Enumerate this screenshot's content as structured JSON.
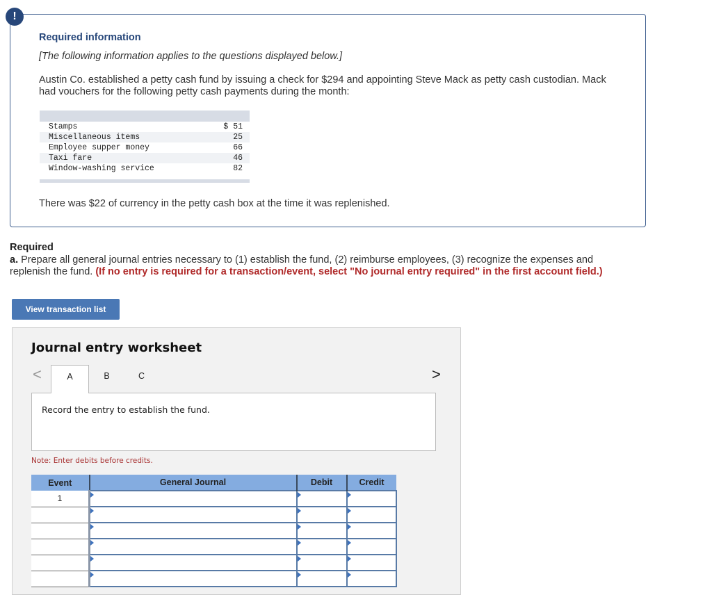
{
  "alert_icon": "!",
  "info": {
    "title": "Required information",
    "italic_note": "[The following information applies to the questions displayed below.]",
    "paragraph": "Austin Co. established a petty cash fund by issuing a check for $294 and appointing Steve Mack as petty cash custodian. Mack had vouchers for the following petty cash payments during the month:",
    "payments": [
      {
        "item": "Stamps",
        "amount": "$ 51"
      },
      {
        "item": "Miscellaneous items",
        "amount": "25"
      },
      {
        "item": "Employee supper money",
        "amount": "66"
      },
      {
        "item": "Taxi fare",
        "amount": "46"
      },
      {
        "item": "Window-washing service",
        "amount": "82"
      }
    ],
    "after_text": "There was $22 of currency in the petty cash box at the time it was replenished."
  },
  "required": {
    "title": "Required",
    "part_label": "a.",
    "text": " Prepare all general journal entries necessary to (1) establish the fund, (2) reimburse employees, (3) recognize the expenses and replenish the fund. ",
    "red_note": "(If no entry is required for a transaction/event, select \"No journal entry required\" in the first account field.)"
  },
  "view_button": "View transaction list",
  "worksheet": {
    "title": "Journal entry worksheet",
    "prev_icon": "<",
    "next_icon": ">",
    "tabs": [
      "A",
      "B",
      "C"
    ],
    "active_tab": "A",
    "instruction": "Record the entry to establish the fund.",
    "note": "Note: Enter debits before credits.",
    "columns": [
      "Event",
      "General Journal",
      "Debit",
      "Credit"
    ],
    "rows": [
      {
        "event": "1",
        "account": "",
        "debit": "",
        "credit": ""
      },
      {
        "event": "",
        "account": "",
        "debit": "",
        "credit": ""
      },
      {
        "event": "",
        "account": "",
        "debit": "",
        "credit": ""
      },
      {
        "event": "",
        "account": "",
        "debit": "",
        "credit": ""
      },
      {
        "event": "",
        "account": "",
        "debit": "",
        "credit": ""
      },
      {
        "event": "",
        "account": "",
        "debit": "",
        "credit": ""
      }
    ]
  }
}
